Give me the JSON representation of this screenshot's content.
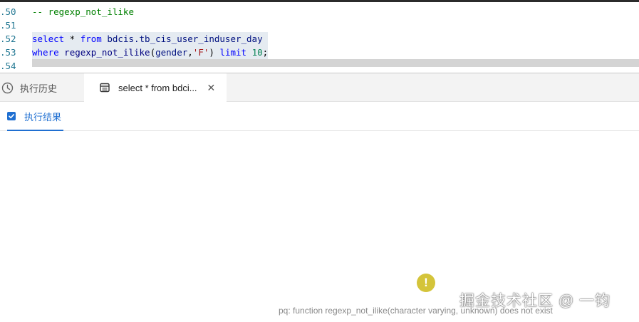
{
  "editor": {
    "lines": [
      {
        "num": ".50",
        "tokens": [
          {
            "t": "-- regexp_not_ilike",
            "c": "cmt"
          }
        ]
      },
      {
        "num": ".51",
        "tokens": []
      },
      {
        "num": ".52",
        "sel": true,
        "tokens": [
          {
            "t": "select",
            "c": "kw"
          },
          {
            "t": " * ",
            "c": "pun"
          },
          {
            "t": "from",
            "c": "kw"
          },
          {
            "t": " bdcis.tb_cis_user_induser_day ",
            "c": "id"
          }
        ]
      },
      {
        "num": ".53",
        "sel": true,
        "tokens": [
          {
            "t": "where",
            "c": "kw"
          },
          {
            "t": " regexp_not_ilike",
            "c": "fn"
          },
          {
            "t": "(",
            "c": "pun"
          },
          {
            "t": "gender",
            "c": "id"
          },
          {
            "t": ",",
            "c": "pun"
          },
          {
            "t": "'F'",
            "c": "str"
          },
          {
            "t": ") ",
            "c": "pun"
          },
          {
            "t": "limit",
            "c": "kw"
          },
          {
            "t": " ",
            "c": "pun"
          },
          {
            "t": "10",
            "c": "num"
          },
          {
            "t": ";",
            "c": "pun"
          }
        ]
      },
      {
        "num": ".54",
        "tokens": [],
        "current": true
      }
    ]
  },
  "tabs": {
    "history_label": "执行历史",
    "query_label": "select * from bdci...",
    "close_symbol": "✕"
  },
  "subtabs": {
    "result_label": "执行结果"
  },
  "result": {
    "warning_symbol": "!",
    "error_message": "pq: function regexp_not_ilike(character varying, unknown) does not exist"
  },
  "watermark": "掘金技术社区 @ 一钧",
  "colors": {
    "accent": "#1f6fd1",
    "warning": "#d4c43a"
  }
}
